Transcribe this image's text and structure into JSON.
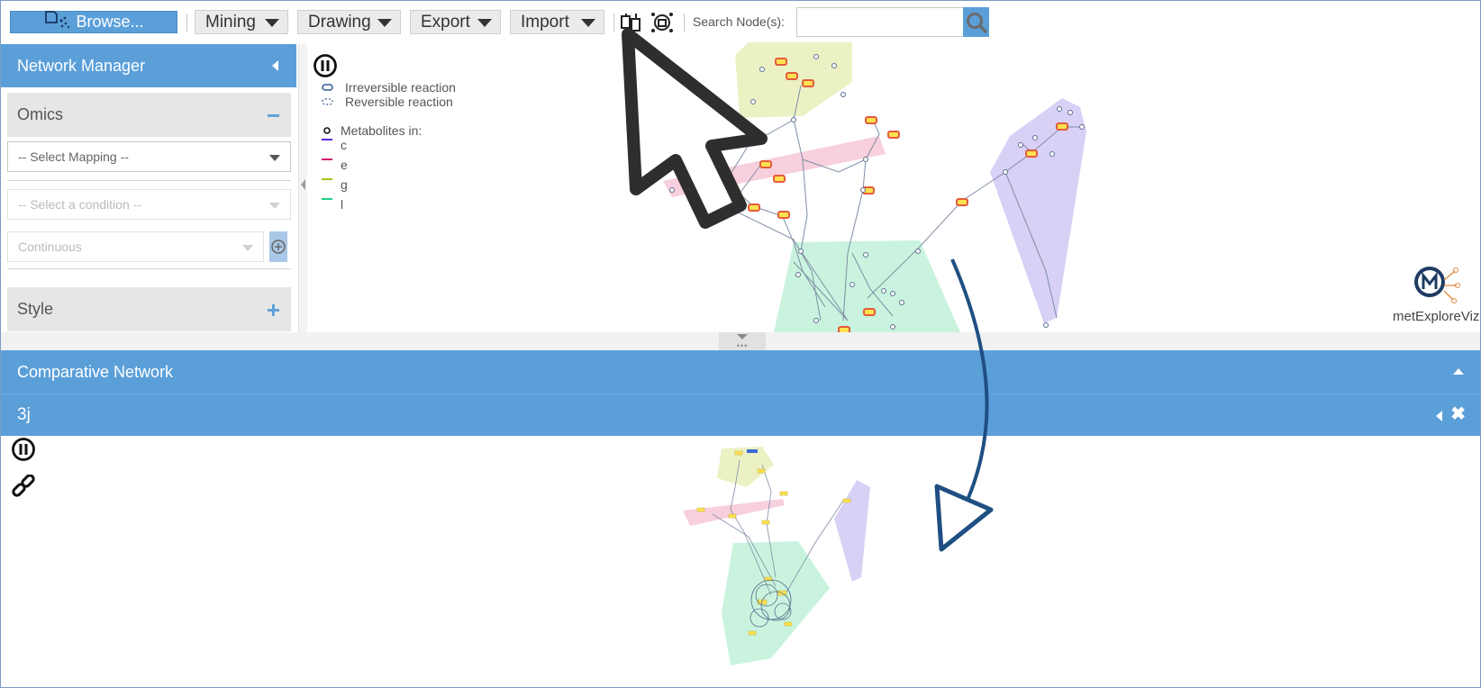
{
  "toolbar": {
    "browse_label": "Browse...",
    "menus": [
      "Mining",
      "Drawing",
      "Export",
      "Import"
    ],
    "search_label": "Search Node(s):",
    "search_value": ""
  },
  "network_manager": {
    "title": "Network Manager",
    "omics": {
      "title": "Omics",
      "toggle": "−",
      "select_mapping": "-- Select Mapping --",
      "select_condition": "-- Select a condition --",
      "scale": "Continuous"
    },
    "style": {
      "title": "Style",
      "toggle": "+"
    }
  },
  "legend": {
    "irreversible": "Irreversible reaction",
    "reversible": "Reversible reaction",
    "metabolites_in": "Metabolites in:",
    "compartments": [
      {
        "label": "c",
        "color": "#5a2bd6"
      },
      {
        "label": "e",
        "color": "#d6176e"
      },
      {
        "label": "g",
        "color": "#a6c41a"
      },
      {
        "label": "l",
        "color": "#1fd38a"
      }
    ]
  },
  "logo": {
    "text": "metExploreViz"
  },
  "comparative": {
    "title": "Comparative Network",
    "tab_label": "3j"
  },
  "colors": {
    "accent": "#5b9fd9",
    "hull_yellow": "#ecf1c4",
    "hull_pink": "#f8cfdc",
    "hull_green": "#c9f3de",
    "hull_purple": "#d9d0f6",
    "reaction_fill": "#ffe14f",
    "reaction_border": "#e35c3c"
  },
  "icons": [
    "browse-icon",
    "caret-down-icon",
    "compare-networks-icon",
    "network-settings-icon",
    "search-icon",
    "pause-icon",
    "link-icon",
    "collapse-left-icon",
    "expand-up-icon",
    "close-icon",
    "metexploreviz-logo",
    "mouse-cursor",
    "drag-arrow"
  ]
}
